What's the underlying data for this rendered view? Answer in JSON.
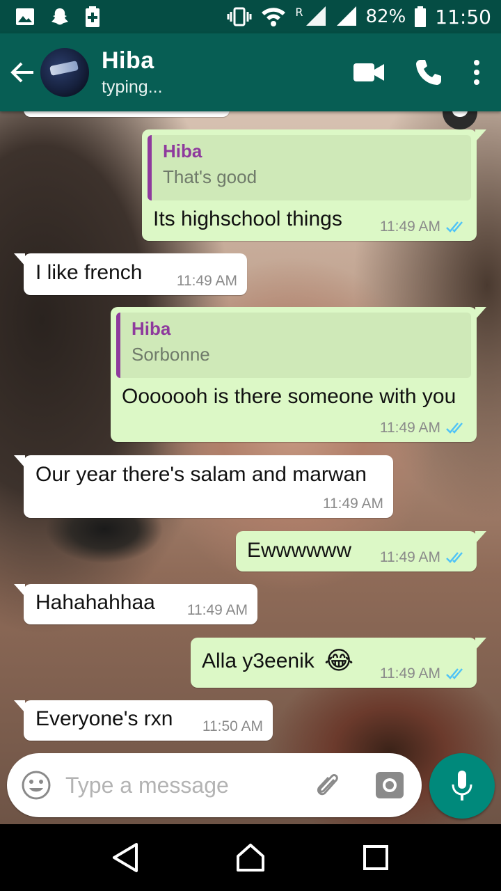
{
  "status_bar": {
    "battery_percent": "82%",
    "time": "11:50",
    "network_roaming": "R",
    "icons": [
      "gallery-icon",
      "snapchat-icon",
      "battery-saver-icon",
      "vibrate-icon",
      "wifi-icon",
      "signal-icon",
      "battery-icon"
    ]
  },
  "header": {
    "contact_name": "Hiba",
    "status": "typing...",
    "icons": [
      "back-arrow-icon",
      "video-call-icon",
      "phone-icon",
      "more-vert-icon"
    ],
    "color": "#075e54"
  },
  "messages": [
    {
      "dir": "out",
      "quote": {
        "name": "Hiba",
        "text": "That's good"
      },
      "text": "Its highschool things",
      "time": "11:49 AM",
      "read": true
    },
    {
      "dir": "in",
      "text": "I like french",
      "time": "11:49 AM"
    },
    {
      "dir": "out",
      "quote": {
        "name": "Hiba",
        "text": "Sorbonne"
      },
      "text": "Ooooooh is there someone with you",
      "time": "11:49 AM",
      "read": true
    },
    {
      "dir": "in",
      "text": "Our year there's salam and marwan",
      "time": "11:49 AM"
    },
    {
      "dir": "out",
      "text": "Ewwwwww",
      "time": "11:49 AM",
      "read": true
    },
    {
      "dir": "in",
      "text": "Hahahahhaa",
      "time": "11:49 AM"
    },
    {
      "dir": "out",
      "text": "Alla y3eenik",
      "emoji": "😂",
      "time": "11:49 AM",
      "read": true
    },
    {
      "dir": "in",
      "text": "Everyone's rxn",
      "time": "11:50 AM"
    }
  ],
  "input": {
    "placeholder": "Type a message",
    "icons": [
      "emoji-icon",
      "attach-icon",
      "camera-icon",
      "mic-icon"
    ]
  },
  "colors": {
    "outgoing_bubble": "#dcf8c6",
    "incoming_bubble": "#ffffff",
    "read_ticks": "#4fc3f7",
    "quote_accent": "#8e3a9d",
    "mic_button": "#00897b"
  }
}
